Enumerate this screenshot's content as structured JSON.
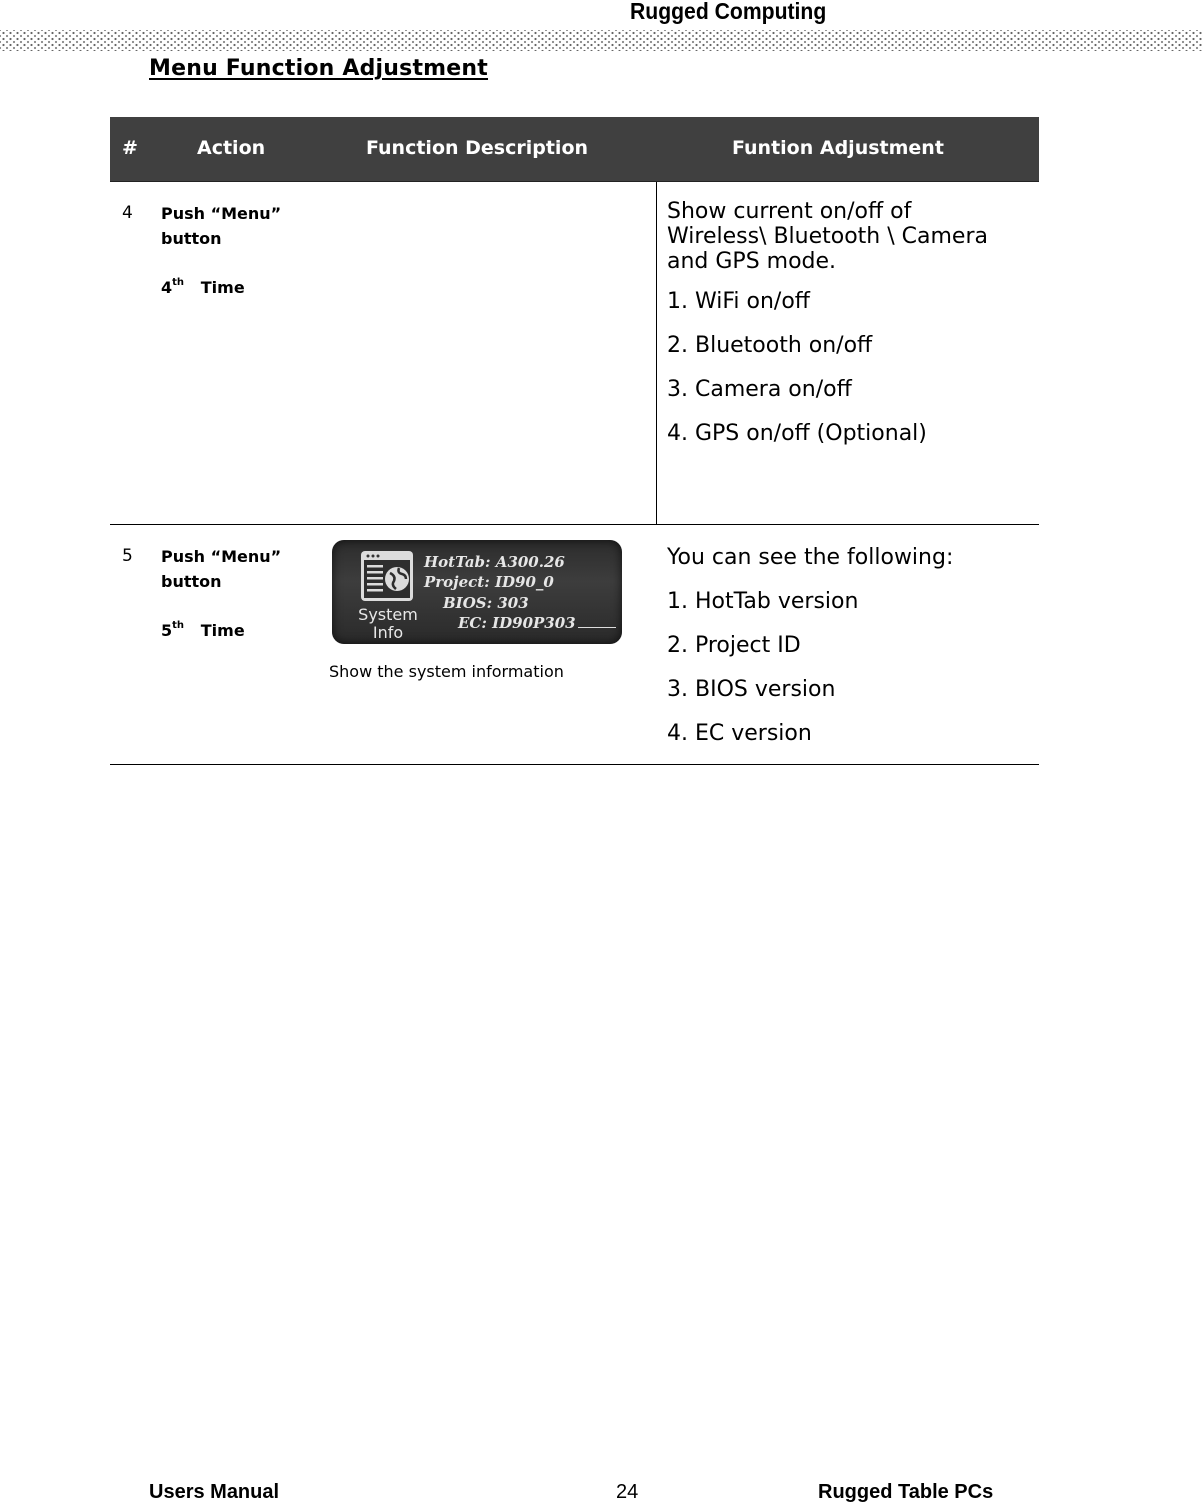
{
  "header": {
    "title": "Rugged  Computing"
  },
  "section_title": "Menu Function Adjustment",
  "table": {
    "columns": [
      "#",
      "Action",
      "Function Description",
      "Funtion Adjustment"
    ],
    "rows": [
      {
        "num": "4",
        "action_line1": "Push “Menu”",
        "action_line2": "button",
        "time_ordinal": "4",
        "time_suffix": "th",
        "time_label": "Time",
        "description": "",
        "adjustment_intro": "Show current on/off of Wireless\\ Bluetooth \\ Camera and GPS mode.",
        "adjustment_items": [
          "1.  WiFi on/off",
          "2.  Bluetooth on/off",
          "3.  Camera on/off",
          "4.  GPS on/off (Optional)"
        ]
      },
      {
        "num": "5",
        "action_line1": "Push “Menu”",
        "action_line2": "button",
        "time_ordinal": "5",
        "time_suffix": "th",
        "time_label": "Time",
        "description_image": {
          "icon": "system-info-icon",
          "label_line1": "System",
          "label_line2": "Info",
          "lines": [
            "HotTab: A300.26",
            "Project: ID90_0",
            "BIOS: 303",
            "EC: ID90P303"
          ]
        },
        "description": "Show the system information",
        "adjustment_intro": "You can see the following:",
        "adjustment_items": [
          "1.  HotTab version",
          "2.  Project ID",
          "3.  BIOS version",
          "4.  EC version"
        ]
      }
    ]
  },
  "footer": {
    "left": "Users Manual",
    "page_number": "24",
    "right": "Rugged Table PCs"
  },
  "colors": {
    "table_header_bg": "#404040",
    "table_header_text": "#ffffff"
  }
}
